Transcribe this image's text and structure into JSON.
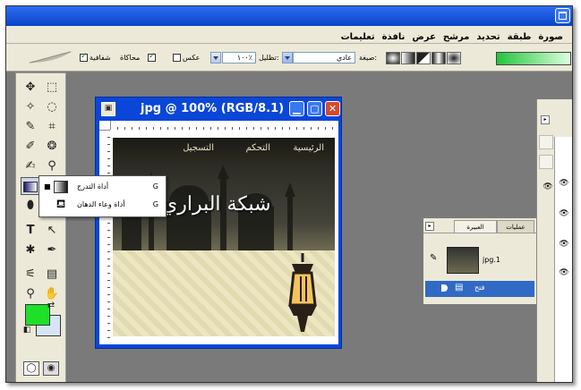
{
  "colors": {
    "foreground": "#1ee029",
    "background": "#d6e5f6",
    "title_bar": "#0a46d8",
    "layer_selected": "#316ac5",
    "workspace": "#7a7a7a"
  },
  "menubar": {
    "items": [
      "صورة",
      "طبقة",
      "تحديد",
      "مرشح",
      "عرض",
      "نافذة",
      "تعليمات"
    ]
  },
  "options_bar": {
    "gradient_label": "صيغة:",
    "mode_label": "عادي",
    "opacity_label": "تظليل:",
    "opacity_value": "١٠٠٪",
    "reverse_label": "عكس",
    "dither_label": "محاكاة",
    "transparency_label": "شفافية",
    "reverse_checked": false,
    "dither_checked": true,
    "transparency_checked": true,
    "gradient_colors": [
      "#24c43c",
      "#dcffdf"
    ]
  },
  "tool_popup": {
    "items": [
      {
        "label": "أداة التدرج",
        "shortcut": "G",
        "icon": "gradient-tool-icon",
        "active": true
      },
      {
        "label": "أداة وعاء الدهان",
        "shortcut": "G",
        "icon": "paint-bucket-icon",
        "active": false
      }
    ]
  },
  "document": {
    "title": "jpg @ 100% (RGB/8.1)",
    "nav_items": [
      "الرئيسية",
      "التحكم",
      "التسجيل"
    ],
    "site_title": "شبكة البراري"
  },
  "layers_panel": {
    "tab_layers": "عمليات",
    "tab_paths": "العبيرة",
    "layers": [
      {
        "name": "jpg.1",
        "selected": false
      },
      {
        "name": "فتح",
        "selected": true
      }
    ]
  }
}
